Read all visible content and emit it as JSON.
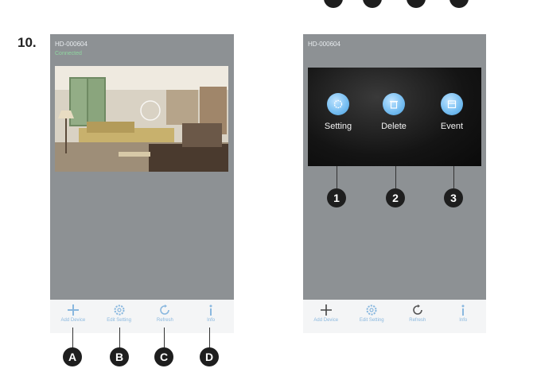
{
  "step_number": "10.",
  "left_phone": {
    "camera_name": "HD-000604",
    "camera_status": "Connected",
    "toolbar": [
      {
        "icon": "plus-icon",
        "label": "Add Device"
      },
      {
        "icon": "gear-icon",
        "label": "Edit Setting"
      },
      {
        "icon": "refresh-icon",
        "label": "Refresh"
      },
      {
        "icon": "info-icon",
        "label": "Info"
      }
    ],
    "callouts": [
      "A",
      "B",
      "C",
      "D"
    ]
  },
  "right_phone": {
    "camera_name": "HD-000604",
    "menu": [
      {
        "icon": "settings-icon",
        "label": "Setting"
      },
      {
        "icon": "delete-icon",
        "label": "Delete"
      },
      {
        "icon": "event-icon",
        "label": "Event"
      }
    ],
    "callouts": [
      "1",
      "2",
      "3"
    ],
    "toolbar": [
      {
        "icon": "plus-icon",
        "label": "Add Device"
      },
      {
        "icon": "gear-icon",
        "label": "Edit Setting"
      },
      {
        "icon": "refresh-icon",
        "label": "Refresh"
      },
      {
        "icon": "info-icon",
        "label": "Info"
      }
    ]
  },
  "colors": {
    "phone_bg": "#8d9194",
    "toolbar_icon": "#8ab8df",
    "callout": "#1e1e1e"
  }
}
